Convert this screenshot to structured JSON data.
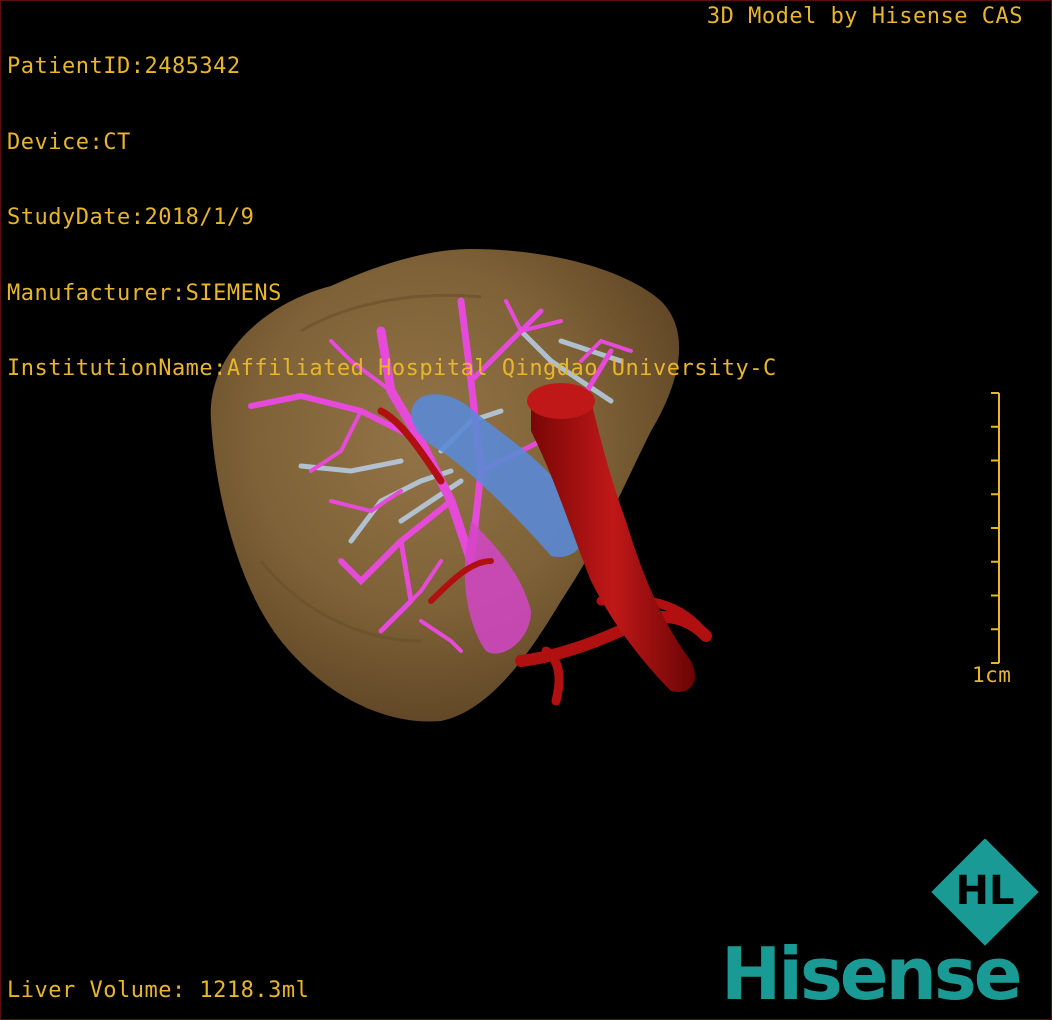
{
  "header": {
    "patient_id": "PatientID:2485342",
    "device": "Device:CT",
    "study_date": "StudyDate:2018/1/9",
    "manufacturer": "Manufacturer:SIEMENS",
    "institution": "InstitutionName:Affiliated Hospital Qingdao University-C",
    "vendor": "3D Model by Hisense CAS"
  },
  "footer": {
    "liver_volume": "Liver Volume: 1218.3ml"
  },
  "scale": {
    "label": "1cm",
    "ticks": 8
  },
  "logo": {
    "brand": "Hisense",
    "mark": "HL",
    "color": "#1a9a95"
  },
  "model_colors": {
    "liver": "#8a6a3c",
    "hepatic_vein": "#e64ad8",
    "portal_vein": "#5a8ad6",
    "artery": "#b01010",
    "bile_duct": "#b8d0e8"
  },
  "text_color": "#e8b62a"
}
